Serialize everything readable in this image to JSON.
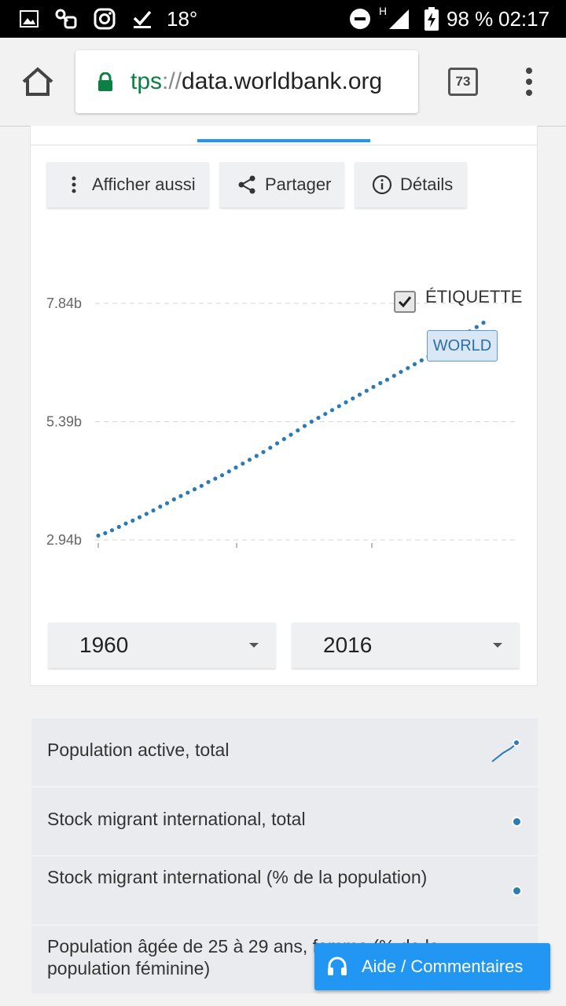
{
  "status_bar": {
    "temperature": "18°",
    "network": "H",
    "battery": "98 %",
    "time": "02:17"
  },
  "browser": {
    "url_scheme": "tps",
    "url_sep": "://",
    "url_host": "data.worldbank.org",
    "tab_count": "73"
  },
  "toolbar": {
    "show_also": "Afficher aussi",
    "share": "Partager",
    "details": "Détails"
  },
  "chart_data": {
    "type": "scatter",
    "x": [
      1960,
      1961,
      1962,
      1963,
      1964,
      1965,
      1966,
      1967,
      1968,
      1969,
      1970,
      1971,
      1972,
      1973,
      1974,
      1975,
      1976,
      1977,
      1978,
      1979,
      1980,
      1981,
      1982,
      1983,
      1984,
      1985,
      1986,
      1987,
      1988,
      1989,
      1990,
      1991,
      1992,
      1993,
      1994,
      1995,
      1996,
      1997,
      1998,
      1999,
      2000,
      2001,
      2002,
      2003,
      2004,
      2005,
      2006,
      2007,
      2008,
      2009,
      2010,
      2011,
      2012,
      2013,
      2014,
      2015,
      2016
    ],
    "series": [
      {
        "name": "WORLD",
        "values": [
          3.03,
          3.08,
          3.14,
          3.21,
          3.28,
          3.34,
          3.41,
          3.48,
          3.55,
          3.63,
          3.7,
          3.78,
          3.85,
          3.92,
          3.99,
          4.06,
          4.14,
          4.21,
          4.28,
          4.36,
          4.44,
          4.52,
          4.6,
          4.68,
          4.76,
          4.85,
          4.94,
          5.03,
          5.12,
          5.21,
          5.3,
          5.39,
          5.47,
          5.55,
          5.63,
          5.71,
          5.79,
          5.87,
          5.95,
          6.03,
          6.11,
          6.19,
          6.26,
          6.34,
          6.42,
          6.5,
          6.58,
          6.66,
          6.74,
          6.82,
          6.91,
          7.0,
          7.08,
          7.17,
          7.26,
          7.35,
          7.44
        ]
      }
    ],
    "yticks": [
      "7.84b",
      "5.39b",
      "2.94b"
    ],
    "ylim": [
      2.94,
      7.84
    ],
    "xlim": [
      1960,
      2016
    ],
    "grid": true,
    "label_toggle": "ÉTIQUETTE",
    "label_checked": true,
    "series_label": "WORLD",
    "color": "#2a7ab8"
  },
  "range": {
    "start_year": "1960",
    "end_year": "2016"
  },
  "related_indicators": [
    {
      "label": "Population active, total",
      "icon": "sparkline-icon"
    },
    {
      "label": "Stock migrant international, total",
      "icon": "dot-icon"
    },
    {
      "label": "Stock migrant international (% de la population)",
      "icon": "dot-icon"
    },
    {
      "label": "Population âgée de 25 à 29 ans, femme (% de la population féminine)",
      "icon": "sparkline-icon"
    }
  ],
  "help_button": "Aide / Commentaires"
}
